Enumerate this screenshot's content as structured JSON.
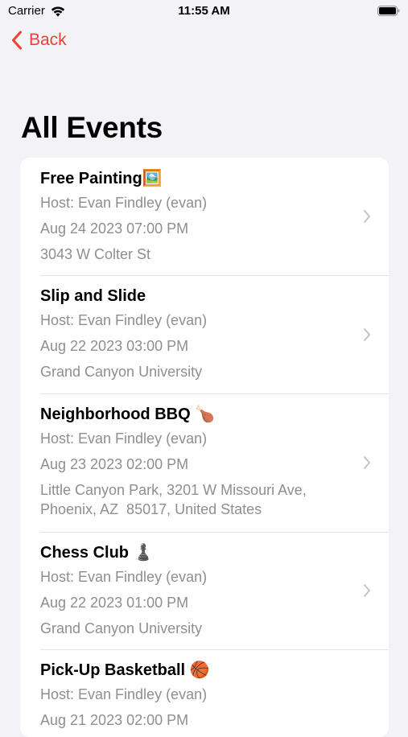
{
  "status_bar": {
    "carrier": "Carrier",
    "time": "11:55 AM",
    "wifi_icon": "wifi-icon",
    "battery_icon": "battery-icon"
  },
  "nav": {
    "back_label": "Back",
    "accent_color": "#ef4034"
  },
  "page": {
    "title": "All Events"
  },
  "events": [
    {
      "title": "Free Painting🖼️",
      "host": "Host: Evan Findley (evan)",
      "date": "Aug 24 2023 07:00 PM",
      "location": "3043 W Colter St"
    },
    {
      "title": "Slip and Slide",
      "host": "Host: Evan Findley (evan)",
      "date": "Aug 22 2023 03:00 PM",
      "location": "Grand Canyon University"
    },
    {
      "title": "Neighborhood BBQ 🍗",
      "host": "Host: Evan Findley (evan)",
      "date": "Aug 23 2023 02:00 PM",
      "location": "Little Canyon Park, 3201 W Missouri Ave, Phoenix, AZ  85017, United States"
    },
    {
      "title": "Chess Club ♟️",
      "host": "Host: Evan Findley (evan)",
      "date": "Aug 22 2023 01:00 PM",
      "location": "Grand Canyon University"
    },
    {
      "title": "Pick-Up Basketball 🏀",
      "host": "Host: Evan Findley (evan)",
      "date": "Aug 21 2023 02:00 PM",
      "location": ""
    }
  ]
}
